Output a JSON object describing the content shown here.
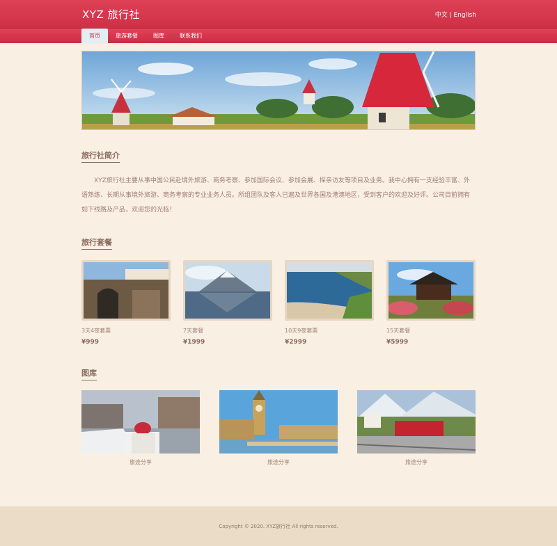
{
  "header": {
    "logo": "XYZ 旅行社",
    "lang_cn": "中文",
    "lang_sep": " | ",
    "lang_en": "English"
  },
  "nav": {
    "items": [
      {
        "label": "首页",
        "active": true
      },
      {
        "label": "旅游套餐",
        "active": false
      },
      {
        "label": "图库",
        "active": false
      },
      {
        "label": "联系我们",
        "active": false
      }
    ]
  },
  "intro": {
    "title": "旅行社简介",
    "text": "XYZ旅行社主要从事中国公民赴境外旅游、商务考察、参加国际会议、参加会展、探亲访友等项目及业务。我中心拥有一支经验丰富、外语熟练、长期从事境外旅游、商务考察的专业业务人员。所组团队及客人已遍及世界各国及港澳地区，受到客户的欢迎及好评。公司目前拥有如下线路及产品，欢迎您的光临！"
  },
  "packages": {
    "title": "旅行套餐",
    "items": [
      {
        "name": "3天4夜套票",
        "price": "¥999"
      },
      {
        "name": "7天套餐",
        "price": "¥1999"
      },
      {
        "name": "10天9夜套票",
        "price": "¥2999"
      },
      {
        "name": "15天套餐",
        "price": "¥5999"
      }
    ]
  },
  "gallery": {
    "title": "图库",
    "items": [
      {
        "caption": "旅途分享"
      },
      {
        "caption": "旅途分享"
      },
      {
        "caption": "旅途分享"
      }
    ]
  },
  "footer": {
    "copyright": "Copyright © 2020. XYZ旅行社 All rights reserved."
  },
  "colors": {
    "brand": "#d83a50",
    "background": "#f9efe2",
    "footer": "#eadcc6"
  }
}
